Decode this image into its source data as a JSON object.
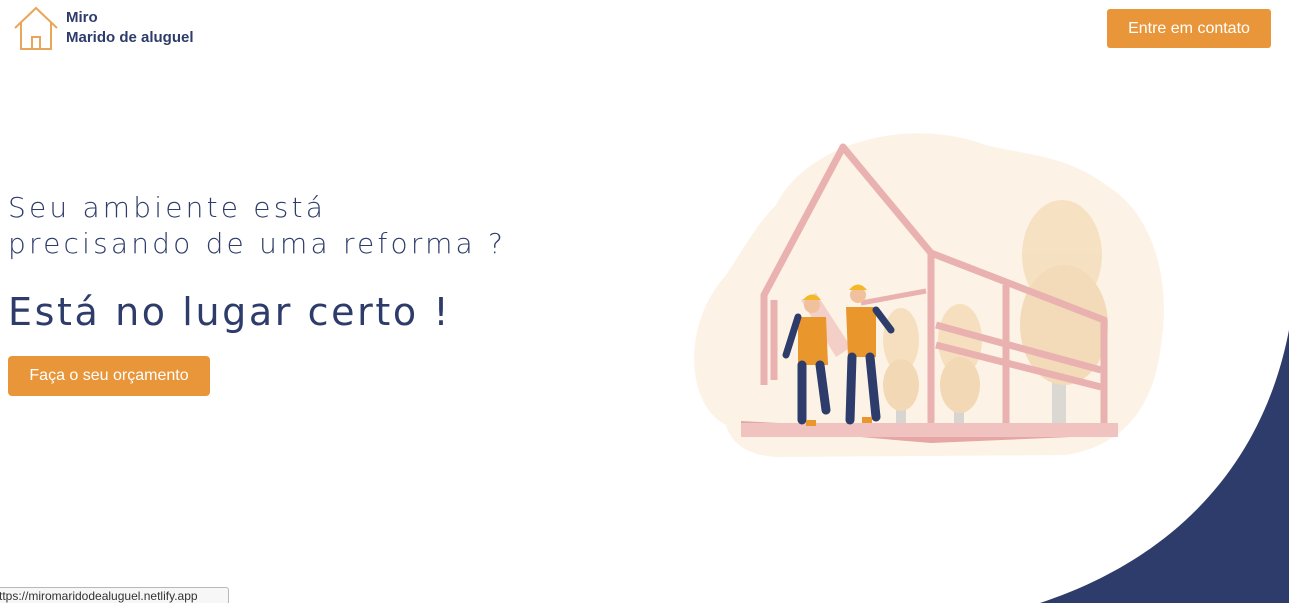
{
  "header": {
    "logo_line1": "Miro",
    "logo_line2": "Marido de aluguel",
    "contact_button": "Entre em contato"
  },
  "hero": {
    "subtitle_line1": "Seu ambiente está",
    "subtitle_line2": "precisando de uma reforma ?",
    "title": "Está no lugar certo !",
    "quote_button": "Faça o seu orçamento"
  },
  "status_bar": {
    "url": "ttps://miromaridodealuguel.netlify.app"
  },
  "icons": [
    "house-logo-icon"
  ],
  "colors": {
    "accent": "#e9963a",
    "navy": "#2d3c6a",
    "illustration_bg": "#fcf3e6",
    "frame": "#e9b2b0"
  }
}
